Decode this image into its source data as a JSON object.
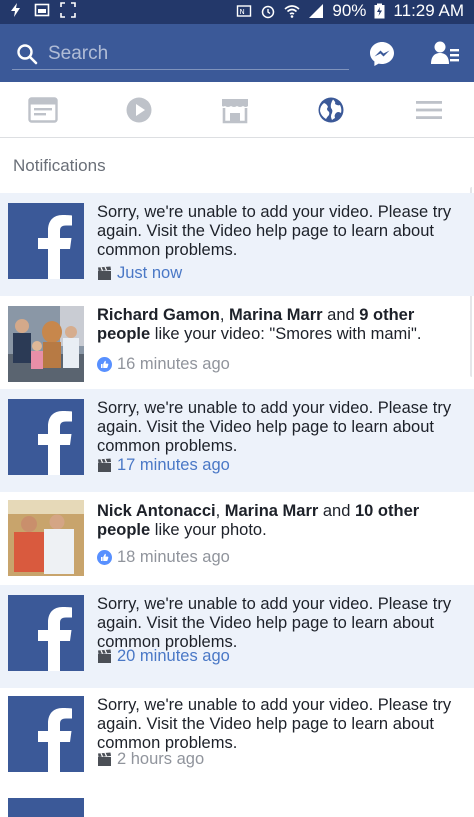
{
  "status_bar": {
    "battery": "90%",
    "time": "11:29 AM"
  },
  "header": {
    "search_placeholder": "Search"
  },
  "tabs": [
    {
      "name": "news-feed",
      "icon": "newsfeed-icon"
    },
    {
      "name": "video",
      "icon": "play-icon"
    },
    {
      "name": "marketplace",
      "icon": "store-icon"
    },
    {
      "name": "notifications",
      "icon": "globe-icon",
      "active": true
    },
    {
      "name": "menu",
      "icon": "hamburger-icon"
    }
  ],
  "notifications": {
    "title": "Notifications",
    "items": [
      {
        "text": "Sorry, we're unable to add your video. Please try again. Visit the Video help page to learn about common problems.",
        "time": "Just now",
        "icon": "video-clapper-icon"
      },
      {
        "name1": "Richard Gamon",
        "sep1": ", ",
        "name2": "Marina Marr",
        "conj": " and ",
        "others": "9 other people",
        "rest": " like your video: \"Smores with mami\".",
        "time": "16 minutes ago",
        "icon": "like-icon"
      },
      {
        "text": "Sorry, we're unable to add your video. Please try again. Visit the Video help page to learn about common problems.",
        "time": "17 minutes ago",
        "icon": "video-clapper-icon"
      },
      {
        "name1": "Nick Antonacci",
        "sep1": ", ",
        "name2": "Marina Marr",
        "conj": " and ",
        "others": "10 other people",
        "rest": " like your photo.",
        "time": "18 minutes ago",
        "icon": "like-icon"
      },
      {
        "text": "Sorry, we're unable to add your video. Please try again. Visit the Video help page to learn about common problems.",
        "time": "20 minutes ago",
        "icon": "video-clapper-icon"
      },
      {
        "text": "Sorry, we're unable to add your video. Please try again. Visit the Video help page to learn about common problems.",
        "time": "2 hours ago",
        "icon": "video-clapper-icon"
      }
    ]
  },
  "colors": {
    "brand": "#3b5998",
    "unread_bg": "#edf2fa",
    "link_time": "#4a78c6",
    "muted": "#90949c"
  }
}
